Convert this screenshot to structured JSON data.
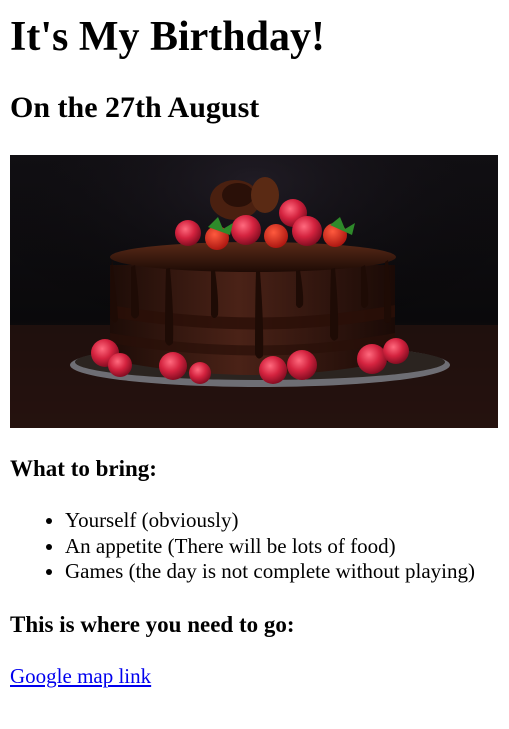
{
  "page": {
    "title": "It's My Birthday!",
    "subtitle": "On the 27th August"
  },
  "hero_image": {
    "subject": "chocolate cake with raspberries and strawberries",
    "colors": {
      "background": "#0b0a0c",
      "cake": "#3a1a12",
      "ganache": "#241008",
      "raspberry": "#d4233f",
      "plate": "#7a7a80"
    }
  },
  "bring": {
    "heading": "What to bring:",
    "items": [
      "Yourself (obviously)",
      "An appetite (There will be lots of food)",
      "Games (the day is not complete without playing)"
    ]
  },
  "location": {
    "heading": "This is where you need to go:",
    "link_text": "Google map link"
  }
}
